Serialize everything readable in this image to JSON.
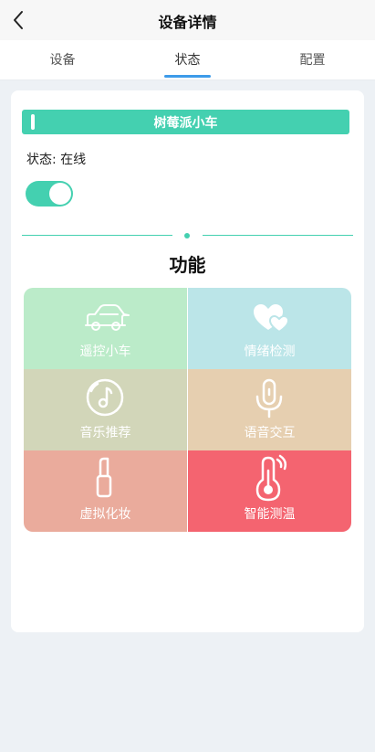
{
  "header": {
    "title": "设备详情"
  },
  "tabs": [
    {
      "label": "设备"
    },
    {
      "label": "状态"
    },
    {
      "label": "配置"
    }
  ],
  "device": {
    "name": "树莓派小车",
    "status": "状态: 在线",
    "toggle_on": true
  },
  "section_title": "功能",
  "functions": [
    {
      "label": "遥控小车",
      "icon": "car-icon",
      "color": "#bbebc9"
    },
    {
      "label": "情绪检测",
      "icon": "hearts-icon",
      "color": "#bbe5e8"
    },
    {
      "label": "音乐推荐",
      "icon": "music-disc-icon",
      "color": "#d2d6b9"
    },
    {
      "label": "语音交互",
      "icon": "microphone-icon",
      "color": "#e6cfb0"
    },
    {
      "label": "虚拟化妆",
      "icon": "lipstick-icon",
      "color": "#eaab9c"
    },
    {
      "label": "智能测温",
      "icon": "thermometer-icon",
      "color": "#f46470"
    }
  ],
  "colors": {
    "accent": "#44d0b0",
    "tab_indicator": "#3d9be9"
  }
}
